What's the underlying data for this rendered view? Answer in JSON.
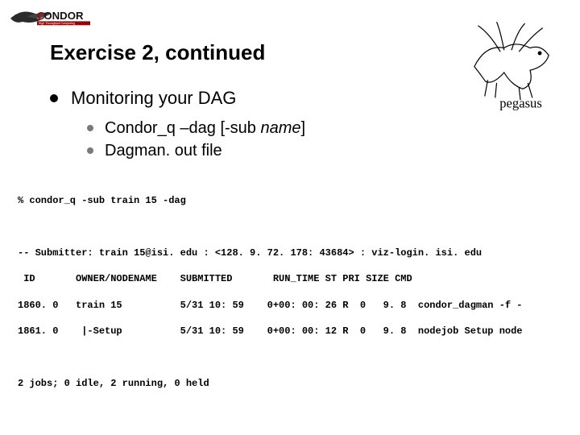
{
  "logos": {
    "left_name": "condor-logo",
    "right_name": "pegasus-logo",
    "right_caption": "pegasus"
  },
  "title": "Exercise 2, continued",
  "bullet": {
    "heading": "Monitoring your DAG",
    "subs": [
      {
        "prefix": "Condor_q –dag [-sub ",
        "italic": "name",
        "suffix": "]"
      },
      {
        "prefix": "Dagman. out file",
        "italic": "",
        "suffix": ""
      }
    ]
  },
  "terminal": {
    "cmd": "% condor_q -sub train 15 -dag",
    "submitter": "-- Submitter: train 15@isi. edu : <128. 9. 72. 178: 43684> : viz-login. isi. edu",
    "header": " ID       OWNER/NODENAME    SUBMITTED       RUN_TIME ST PRI SIZE CMD",
    "rows": [
      "1860. 0   train 15          5/31 10: 59    0+00: 00: 26 R  0   9. 8  condor_dagman -f -",
      "1861. 0    |-Setup          5/31 10: 59    0+00: 00: 12 R  0   9. 8  nodejob Setup node"
    ],
    "footer": "2 jobs; 0 idle, 2 running, 0 held"
  },
  "chart_data": {
    "type": "table",
    "title": "condor_q -sub train15 -dag output",
    "columns": [
      "ID",
      "OWNER/NODENAME",
      "SUBMITTED",
      "RUN_TIME",
      "ST",
      "PRI",
      "SIZE",
      "CMD"
    ],
    "rows": [
      [
        "1860.0",
        "train 15",
        "5/31 10:59",
        "0+00:00:26",
        "R",
        0,
        9.8,
        "condor_dagman -f -"
      ],
      [
        "1861.0",
        "|-Setup",
        "5/31 10:59",
        "0+00:00:12",
        "R",
        0,
        9.8,
        "nodejob Setup node"
      ]
    ],
    "summary": {
      "jobs": 2,
      "idle": 0,
      "running": 2,
      "held": 0
    }
  }
}
